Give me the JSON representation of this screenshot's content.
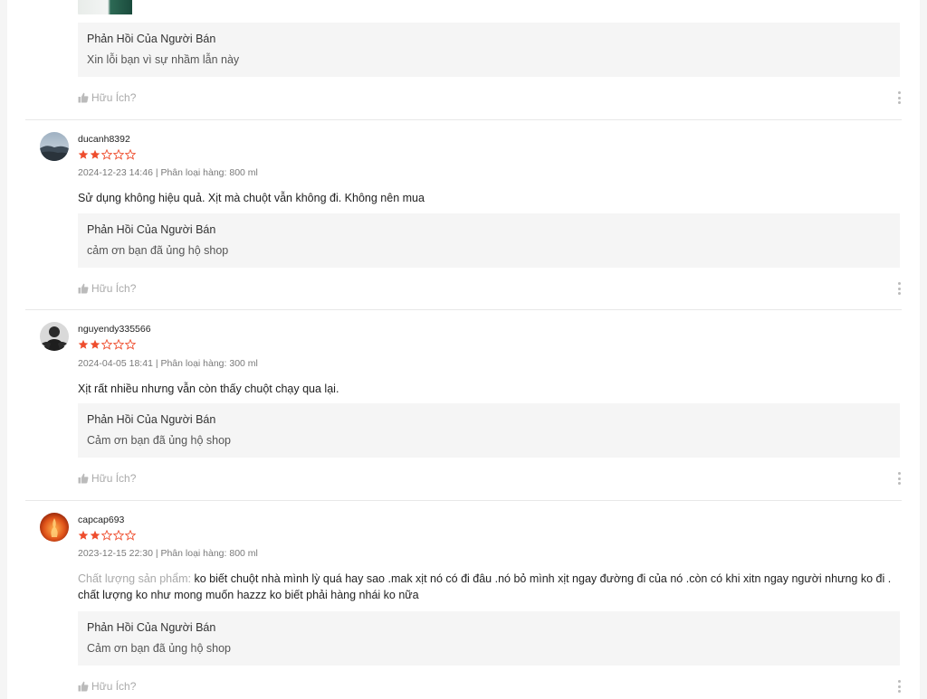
{
  "reply_title": "Phản Hồi Của Người Bán",
  "helpful_label": "Hữu Ích?",
  "star_color": "#ee4d2d",
  "reviews": [
    {
      "seller_reply": "Xin lỗi bạn vì sự nhầm lẫn này"
    },
    {
      "username": "ducanh8392",
      "rating": 2,
      "max_rating": 5,
      "meta": "2024-12-23 14:46 | Phân loại hàng: 800 ml",
      "text": "Sử dụng không hiệu quả. Xịt mà chuột vẫn không đi. Không nên mua",
      "seller_reply": "cảm ơn bạn đã ủng hộ shop"
    },
    {
      "username": "nguyendy335566",
      "rating": 2,
      "max_rating": 5,
      "meta": "2024-04-05 18:41 | Phân loại hàng: 300 ml",
      "text": "Xịt rất nhiều nhưng vẫn còn thấy chuột chạy qua lại.",
      "seller_reply": "Cảm ơn bạn đã ủng hộ shop"
    },
    {
      "username": "capcap693",
      "rating": 2,
      "max_rating": 5,
      "meta": "2023-12-15 22:30 | Phân loại hàng: 800 ml",
      "text_label": "Chất lượng sản phẩm:",
      "text": "ko biết chuột nhà mình lỳ quá hay sao .mak xịt nó có đi đâu .nó bỏ mình xịt ngay đường đi của nó .còn có khi xitn ngay người nhưng ko đi . chất lượng ko như mong muốn hazzz ko biết phải hàng nhái ko nữa",
      "seller_reply": "Cảm ơn bạn đã ủng hộ shop"
    }
  ]
}
